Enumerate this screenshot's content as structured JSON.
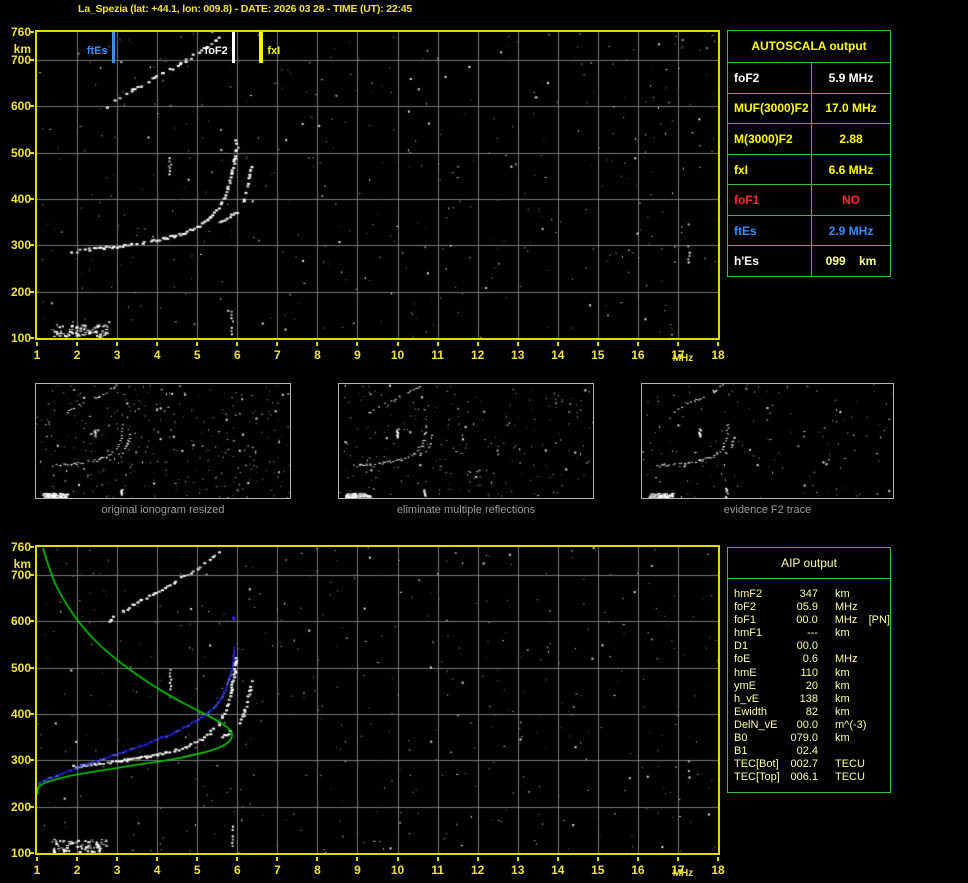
{
  "window": {
    "title": "La_Spezia (lat: +44.1, lon: 009.8) - DATE: 2026 03 28 - TIME (UT): 22:45"
  },
  "colors": {
    "background": "#000000",
    "title_yellow": "#f2e240",
    "plot_border": "#dcdc00",
    "grid_gray": "#7a7a7a",
    "table_border_green": "#3dbd3d",
    "white": "#ffffff",
    "yellow": "#ffff00",
    "red": "#ff2a2a",
    "blue": "#3b8eff",
    "pale_yellow": "#ffffa6",
    "green_curve": "#00d400",
    "blue_trace": "#2828ff",
    "caption_gray": "#9c9c9c"
  },
  "autoscala_table": {
    "header": "AUTOSCALA output",
    "rows": [
      {
        "label": "foF2",
        "value": "5.9 MHz",
        "label_color": "#ffffff",
        "value_color": "#ffffff"
      },
      {
        "label": "MUF(3000)F2",
        "value": "17.0 MHz",
        "label_color": "#ffff00",
        "value_color": "#ffff00"
      },
      {
        "label": "M(3000)F2",
        "value": "2.88",
        "label_color": "#ffff00",
        "value_color": "#ffff00"
      },
      {
        "label": "fxI",
        "value": "6.6 MHz",
        "label_color": "#ffff00",
        "value_color": "#ffff00"
      },
      {
        "label": "foF1",
        "value": "NO",
        "label_color": "#ff2a2a",
        "value_color": "#ff2a2a"
      },
      {
        "label": "ftEs",
        "value": "2.9 MHz",
        "label_color": "#3b8eff",
        "value_color": "#3b8eff"
      },
      {
        "label": "h'Es",
        "value": "099    km",
        "label_color": "#ffffff",
        "value_color": "#ffff99"
      }
    ]
  },
  "aip_table": {
    "header": "AIP output",
    "rows": [
      {
        "label": "hmF2",
        "value": "347",
        "unit": "km",
        "note": ""
      },
      {
        "label": "foF2",
        "value": "05.9",
        "unit": "MHz",
        "note": ""
      },
      {
        "label": "foF1",
        "value": "00.0",
        "unit": "MHz",
        "note": "[PN]"
      },
      {
        "label": "hmF1",
        "value": "---",
        "unit": "km",
        "note": ""
      },
      {
        "label": "D1",
        "value": "00.0",
        "unit": "",
        "note": ""
      },
      {
        "label": "foE",
        "value": "0.6",
        "unit": "MHz",
        "note": ""
      },
      {
        "label": "hmE",
        "value": "110",
        "unit": "km",
        "note": ""
      },
      {
        "label": "ymE",
        "value": "20",
        "unit": "km",
        "note": ""
      },
      {
        "label": "h_vE",
        "value": "138",
        "unit": "km",
        "note": ""
      },
      {
        "label": "Ewidth",
        "value": "82",
        "unit": "km",
        "note": ""
      },
      {
        "label": "DelN_vE",
        "value": "00.0",
        "unit": "m^(-3)",
        "note": ""
      },
      {
        "label": "B0",
        "value": "079.0",
        "unit": "km",
        "note": ""
      },
      {
        "label": "B1",
        "value": "02.4",
        "unit": "",
        "note": ""
      },
      {
        "label": "TEC[Bot]",
        "value": "002.7",
        "unit": "TECU",
        "note": ""
      },
      {
        "label": "TEC[Top]",
        "value": "006.1",
        "unit": "TECU",
        "note": ""
      }
    ]
  },
  "thumbnails": {
    "captions": [
      "original ionogram resized",
      "eliminate multiple reflections",
      "evidence F2 trace"
    ],
    "noise_counts": [
      320,
      240,
      140
    ],
    "seeds": [
      3,
      4,
      5
    ]
  },
  "ionogram_traces": {
    "f2_ordinary": {
      "color": "#ffffff",
      "density": 0.82,
      "points": [
        [
          1.85,
          287
        ],
        [
          2.2,
          292
        ],
        [
          2.6,
          296
        ],
        [
          3.0,
          300
        ],
        [
          3.4,
          304
        ],
        [
          3.8,
          310
        ],
        [
          4.2,
          317
        ],
        [
          4.6,
          327
        ],
        [
          4.95,
          340
        ],
        [
          5.25,
          357
        ],
        [
          5.5,
          380
        ],
        [
          5.68,
          408
        ],
        [
          5.8,
          442
        ],
        [
          5.88,
          478
        ],
        [
          5.93,
          510
        ],
        [
          5.95,
          532
        ]
      ]
    },
    "f2_extraordinary": {
      "color": "#ffffff",
      "density": 0.6,
      "points": [
        [
          5.55,
          350
        ],
        [
          5.75,
          360
        ],
        [
          5.95,
          374
        ],
        [
          6.1,
          394
        ],
        [
          6.2,
          420
        ],
        [
          6.28,
          452
        ],
        [
          6.32,
          477
        ]
      ]
    },
    "second_hop_multiple": {
      "color": "#ffffff",
      "density": 0.52,
      "points": [
        [
          2.68,
          597
        ],
        [
          3.05,
          620
        ],
        [
          3.5,
          643
        ],
        [
          3.95,
          664
        ],
        [
          4.4,
          686
        ],
        [
          4.8,
          706
        ],
        [
          5.15,
          726
        ],
        [
          5.45,
          745
        ],
        [
          5.66,
          760
        ]
      ]
    },
    "es_layer": {
      "f_range": [
        1.35,
        2.75
      ],
      "h_range": [
        104,
        130
      ],
      "count": 80
    },
    "noise_strings": [
      [
        5.85,
        110,
        165
      ],
      [
        4.3,
        455,
        505
      ],
      [
        17.25,
        265,
        305
      ]
    ]
  },
  "chart_data": [
    {
      "id": "top_ionogram",
      "type": "scatter",
      "title": "reflected echo height vs sounding frequency",
      "xlabel": "MHz",
      "ylabel": "km",
      "x_range": [
        1,
        18
      ],
      "y_range": [
        100,
        760
      ],
      "x_ticks": [
        1,
        2,
        3,
        4,
        5,
        6,
        7,
        8,
        9,
        10,
        11,
        12,
        13,
        14,
        15,
        16,
        17,
        18
      ],
      "y_ticks": [
        760,
        700,
        600,
        500,
        400,
        300,
        200,
        100
      ],
      "grid": true,
      "legend": "none",
      "noise_seed": 11,
      "noise_count": 430,
      "traces": [
        "f2_ordinary",
        "f2_extraordinary",
        "second_hop_multiple"
      ],
      "markers": [
        {
          "label": "ftEs",
          "freq_mhz": 2.9,
          "color": "#3b8eff",
          "side": "left",
          "line_w": 3
        },
        {
          "label": "foF2",
          "freq_mhz": 5.9,
          "color": "#ffffff",
          "side": "left",
          "line_w": 3
        },
        {
          "label": "fxI",
          "freq_mhz": 6.6,
          "color": "#f6f600",
          "side": "right",
          "line_w": 4
        }
      ]
    },
    {
      "id": "bottom_ionogram",
      "type": "scatter",
      "title": "autoscaled F2 trace and electron density profile",
      "xlabel": "MHz",
      "ylabel": "km",
      "x_range": [
        1,
        18
      ],
      "y_range": [
        100,
        760
      ],
      "x_ticks": [
        1,
        2,
        3,
        4,
        5,
        6,
        7,
        8,
        9,
        10,
        11,
        12,
        13,
        14,
        15,
        16,
        17,
        18
      ],
      "y_ticks": [
        760,
        700,
        600,
        500,
        400,
        300,
        200,
        100
      ],
      "grid": true,
      "legend": "none",
      "noise_seed": 29,
      "noise_count": 430,
      "traces": [
        "f2_ordinary",
        "f2_extraordinary",
        "second_hop_multiple"
      ],
      "markers": [],
      "profile_line": {
        "name": "plasma-frequency-profile",
        "color": "#00d400",
        "points": [
          [
            1.15,
            758
          ],
          [
            1.35,
            700
          ],
          [
            1.6,
            655
          ],
          [
            1.95,
            608
          ],
          [
            2.35,
            566
          ],
          [
            2.85,
            526
          ],
          [
            3.4,
            490
          ],
          [
            3.95,
            458
          ],
          [
            4.5,
            430
          ],
          [
            5.0,
            408
          ],
          [
            5.45,
            388
          ],
          [
            5.75,
            372
          ],
          [
            5.88,
            360
          ],
          [
            5.86,
            345
          ],
          [
            5.7,
            333
          ],
          [
            5.4,
            322
          ],
          [
            4.9,
            311
          ],
          [
            4.2,
            299
          ],
          [
            3.4,
            289
          ],
          [
            2.6,
            278
          ],
          [
            1.9,
            268
          ],
          [
            1.4,
            258
          ],
          [
            1.1,
            248
          ],
          [
            1.0,
            238
          ],
          [
            1.0,
            225
          ]
        ]
      },
      "scaled_trace": {
        "name": "autoscaled-f2-trace",
        "color": "#2828ff",
        "points": [
          [
            1.02,
            253
          ],
          [
            1.35,
            265
          ],
          [
            1.7,
            277
          ],
          [
            2.1,
            290
          ],
          [
            2.55,
            303
          ],
          [
            3.0,
            316
          ],
          [
            3.45,
            329
          ],
          [
            3.9,
            344
          ],
          [
            4.35,
            360
          ],
          [
            4.75,
            377
          ],
          [
            5.1,
            395
          ],
          [
            5.35,
            412
          ],
          [
            5.55,
            432
          ],
          [
            5.7,
            456
          ],
          [
            5.8,
            482
          ],
          [
            5.87,
            510
          ],
          [
            5.9,
            535
          ],
          [
            5.91,
            548
          ]
        ],
        "lone_point": [
          5.9,
          607
        ]
      }
    }
  ]
}
